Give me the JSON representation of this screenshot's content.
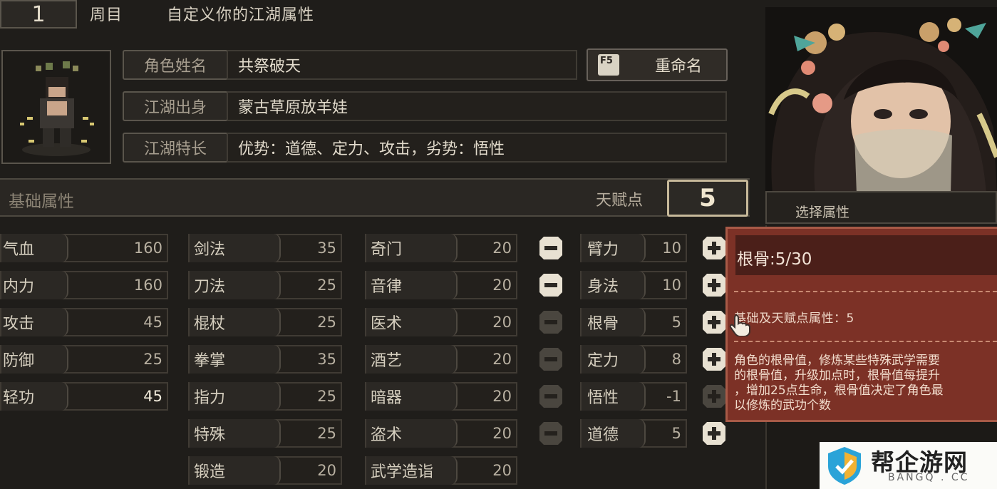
{
  "header": {
    "cycle_number": "1",
    "cycle_label": "周目",
    "title": "自定义你的江湖属性"
  },
  "info": {
    "name_label": "角色姓名",
    "name_value": "共祭破天",
    "origin_label": "江湖出身",
    "origin_value": "蒙古草原放羊娃",
    "specialty_label": "江湖特长",
    "specialty_value": "优势：道德、定力、攻击，劣势：悟性",
    "rename_key": "F5",
    "rename_label": "重命名"
  },
  "base": {
    "title": "基础属性",
    "talent_label": "天赋点",
    "talent_points": "5"
  },
  "stats_col1": [
    {
      "name": "气血",
      "value": "160"
    },
    {
      "name": "内力",
      "value": "160"
    },
    {
      "name": "攻击",
      "value": "45"
    },
    {
      "name": "防御",
      "value": "25"
    },
    {
      "name": "轻功",
      "value": "45"
    }
  ],
  "stats_col2": [
    {
      "name": "剑法",
      "value": "35"
    },
    {
      "name": "刀法",
      "value": "25"
    },
    {
      "name": "棍杖",
      "value": "25"
    },
    {
      "name": "拳掌",
      "value": "35"
    },
    {
      "name": "指力",
      "value": "25"
    },
    {
      "name": "特殊",
      "value": "25"
    },
    {
      "name": "锻造",
      "value": "20"
    }
  ],
  "stats_col3": [
    {
      "name": "奇门",
      "value": "20"
    },
    {
      "name": "音律",
      "value": "20"
    },
    {
      "name": "医术",
      "value": "20"
    },
    {
      "name": "酒艺",
      "value": "20"
    },
    {
      "name": "暗器",
      "value": "20"
    },
    {
      "name": "盗术",
      "value": "20"
    },
    {
      "name": "武学造诣",
      "value": "20"
    }
  ],
  "stats_col4": [
    {
      "name": "臂力",
      "value": "10"
    },
    {
      "name": "身法",
      "value": "10"
    },
    {
      "name": "根骨",
      "value": "5"
    },
    {
      "name": "定力",
      "value": "8"
    },
    {
      "name": "悟性",
      "value": "-1"
    },
    {
      "name": "道德",
      "value": "5"
    }
  ],
  "right_panel": {
    "select_label": "选择属性"
  },
  "tooltip": {
    "title": "根骨:5/30",
    "subtitle": "基础及天赋点属性：5",
    "desc_lines": [
      "角色的根骨值，修炼某些特殊武学需要",
      "的根骨值，升级加点时，根骨值每提升",
      "，增加25点生命，根骨值决定了角色最",
      "以修炼的武功个数"
    ]
  },
  "watermark": {
    "text": "帮企游网",
    "sub": "BANGQ . CC"
  },
  "colors": {
    "accent_red": "#7c3126",
    "talent_border": "#c7b99a",
    "bg": "#1f1d1a"
  }
}
